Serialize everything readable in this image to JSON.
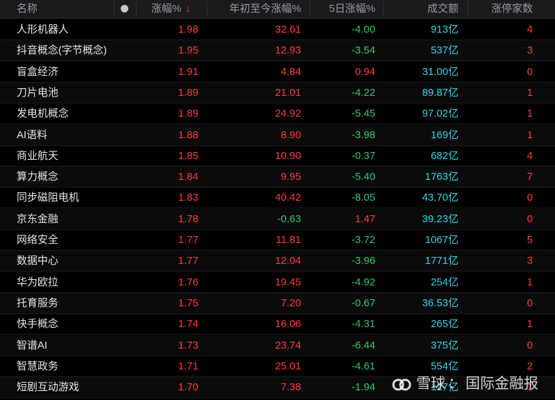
{
  "header": {
    "name": "名称",
    "change_pct": "涨幅%",
    "sort_arrow": "↓",
    "ytd_pct": "年初至今涨幅%",
    "five_day_pct": "5日涨幅%",
    "turnover": "成交额",
    "limit_up_count": "涨停家数"
  },
  "rows": [
    {
      "name": "人形机器人",
      "chg": "1.98",
      "ytd": "32.61",
      "d5": "-4.00",
      "amt": "913亿",
      "lim": "4"
    },
    {
      "name": "抖音概念(字节概念)",
      "chg": "1.95",
      "ytd": "12.93",
      "d5": "-3.54",
      "amt": "537亿",
      "lim": "3"
    },
    {
      "name": "盲盒经济",
      "chg": "1.91",
      "ytd": "4.84",
      "d5": "0.94",
      "amt": "31.00亿",
      "lim": "0"
    },
    {
      "name": "刀片电池",
      "chg": "1.89",
      "ytd": "21.01",
      "d5": "-4.22",
      "amt": "89.87亿",
      "lim": "1"
    },
    {
      "name": "发电机概念",
      "chg": "1.89",
      "ytd": "24.92",
      "d5": "-5.45",
      "amt": "97.02亿",
      "lim": "1"
    },
    {
      "name": "AI语料",
      "chg": "1.88",
      "ytd": "8.90",
      "d5": "-3.98",
      "amt": "169亿",
      "lim": "1"
    },
    {
      "name": "商业航天",
      "chg": "1.85",
      "ytd": "10.90",
      "d5": "-0.37",
      "amt": "682亿",
      "lim": "4"
    },
    {
      "name": "算力概念",
      "chg": "1.84",
      "ytd": "9.95",
      "d5": "-5.40",
      "amt": "1763亿",
      "lim": "7"
    },
    {
      "name": "同步磁阻电机",
      "chg": "1.83",
      "ytd": "40.42",
      "d5": "-8.05",
      "amt": "43.70亿",
      "lim": "0"
    },
    {
      "name": "京东金融",
      "chg": "1.78",
      "ytd": "-0.63",
      "d5": "1.47",
      "amt": "39.23亿",
      "lim": "0"
    },
    {
      "name": "网络安全",
      "chg": "1.77",
      "ytd": "11.81",
      "d5": "-3.72",
      "amt": "1067亿",
      "lim": "5"
    },
    {
      "name": "数据中心",
      "chg": "1.77",
      "ytd": "12.04",
      "d5": "-3.96",
      "amt": "1771亿",
      "lim": "3"
    },
    {
      "name": "华为欧拉",
      "chg": "1.76",
      "ytd": "19.45",
      "d5": "-4.92",
      "amt": "254亿",
      "lim": "1"
    },
    {
      "name": "托育服务",
      "chg": "1.75",
      "ytd": "7.20",
      "d5": "-0.67",
      "amt": "36.53亿",
      "lim": "0"
    },
    {
      "name": "快手概念",
      "chg": "1.74",
      "ytd": "16.06",
      "d5": "-4.31",
      "amt": "265亿",
      "lim": "1"
    },
    {
      "name": "智谱AI",
      "chg": "1.73",
      "ytd": "23.74",
      "d5": "-6.44",
      "amt": "375亿",
      "lim": "0"
    },
    {
      "name": "智慧政务",
      "chg": "1.71",
      "ytd": "25.01",
      "d5": "-4.61",
      "amt": "554亿",
      "lim": "2"
    },
    {
      "name": "短剧互动游戏",
      "chg": "1.70",
      "ytd": "7.38",
      "d5": "-1.94",
      "amt": "127亿",
      "lim": "1"
    }
  ],
  "watermark": {
    "brand": "雪球",
    "separator": "：",
    "account": "国际金融报"
  },
  "colors": {
    "up": "#ff3b3b",
    "down": "#2fc86a",
    "turnover": "#2fd5e8",
    "background": "#000000"
  }
}
